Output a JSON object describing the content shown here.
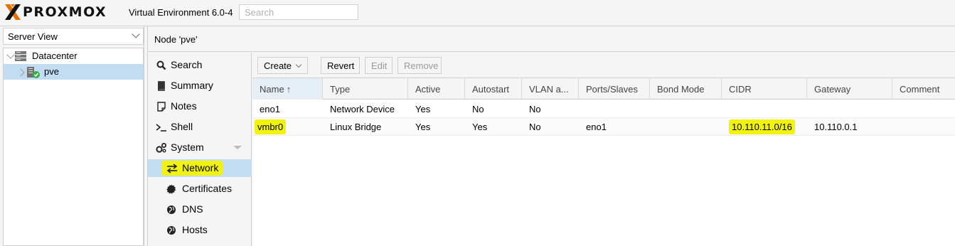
{
  "header": {
    "logo_text": "PROXMOX",
    "version": "Virtual Environment 6.0-4",
    "search_placeholder": "Search"
  },
  "left_panel": {
    "view_selector": "Server View",
    "tree": [
      {
        "label": "Datacenter",
        "icon": "datacenter-icon"
      },
      {
        "label": "pve",
        "icon": "server-node-icon",
        "selected": true
      }
    ]
  },
  "node_header": {
    "title": "Node 'pve'"
  },
  "nav": {
    "items": [
      {
        "label": "Search",
        "icon": "search-icon"
      },
      {
        "label": "Summary",
        "icon": "book-icon"
      },
      {
        "label": "Notes",
        "icon": "notes-icon"
      },
      {
        "label": "Shell",
        "icon": "terminal-icon"
      },
      {
        "label": "System",
        "icon": "gears-icon"
      },
      {
        "label": "Network",
        "icon": "exchange-icon",
        "selected": true
      },
      {
        "label": "Certificates",
        "icon": "certificate-icon"
      },
      {
        "label": "DNS",
        "icon": "globe-icon"
      },
      {
        "label": "Hosts",
        "icon": "globe-icon"
      }
    ]
  },
  "toolbar": {
    "create_label": "Create",
    "revert_label": "Revert",
    "edit_label": "Edit",
    "remove_label": "Remove"
  },
  "table": {
    "columns": [
      "Name",
      "Type",
      "Active",
      "Autostart",
      "VLAN a...",
      "Ports/Slaves",
      "Bond Mode",
      "CIDR",
      "Gateway",
      "Comment"
    ],
    "sort_arrow": "↑",
    "rows": [
      [
        "eno1",
        "Network Device",
        "Yes",
        "No",
        "No",
        "",
        "",
        "",
        "",
        ""
      ],
      [
        "vmbr0",
        "Linux Bridge",
        "Yes",
        "Yes",
        "No",
        "eno1",
        "",
        "10.110.11.0/16",
        "10.110.0.1",
        ""
      ]
    ]
  },
  "colors": {
    "selection": "#c2ddf2",
    "highlight": "#f2f20f",
    "logo_orange": "#e57000",
    "status_green": "#2fb344"
  }
}
